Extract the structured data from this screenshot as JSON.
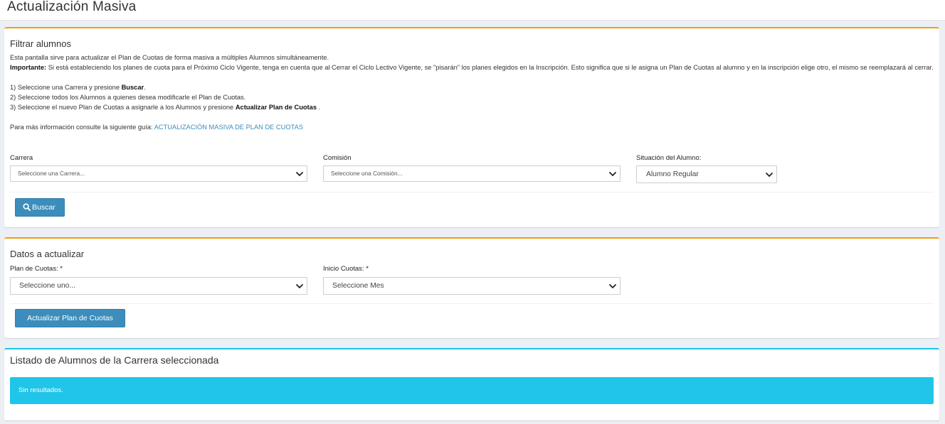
{
  "page": {
    "title": "Actualización Masiva"
  },
  "filter_box": {
    "title": "Filtrar alumnos",
    "intro_line1": "Esta pantalla sirve para actualizar el Plan de Cuotas de forma masiva a múltiples Alumnos simultáneamente.",
    "important_label": "Importante:",
    "important_text": " Si está estableciendo los planes de cuota para el Próximo Ciclo Vigente, tenga en cuenta que al Cerrar el Ciclo Lectivo Vigente, se \"pisarán\" los planes elegidos en la Inscripción. Esto significa que si le asigna un Plan de Cuotas al alumno y en la inscripción elige otro, el mismo se reemplazará al cerrar.",
    "step1_text": "1) Seleccione una Carrera y presione ",
    "step1_bold": "Buscar",
    "step1_end": ".",
    "step2_text": "2) Seleccione todos los Alumnos a quienes desea modificarle el Plan de Cuotas.",
    "step3_text": "3) Seleccione el nuevo Plan de Cuotas a asignarle a los Alumnos y presione ",
    "step3_bold": "Actualizar Plan de Cuotas",
    "step3_end": " .",
    "guide_text": "Para más información consulte la siguiente guía: ",
    "guide_link": "ACTUALIZACIÓN MASIVA DE PLAN DE CUOTAS",
    "carrera_label": "Carrera",
    "carrera_value": "Seleccione una Carrera...",
    "comision_label": "Comisión",
    "comision_value": "Seleccione una Comisión...",
    "situacion_label": "Situación del Alumno:",
    "situacion_value": "Alumno Regular",
    "search_button": "Buscar"
  },
  "update_box": {
    "title": "Datos a actualizar",
    "plan_label": "Plan de Cuotas: *",
    "plan_value": "Seleccione uno...",
    "inicio_label": "Inicio Cuotas: *",
    "inicio_value": "Seleccione Mes",
    "update_button": "Actualizar Plan de Cuotas"
  },
  "list_box": {
    "title": "Listado de Alumnos de la Carrera seleccionada",
    "empty_message": "Sin resultados."
  },
  "colors": {
    "accent_orange": "#f39c12",
    "accent_blue": "#1ec3e8",
    "button": "#3c8dbc",
    "alert": "#20c5e9",
    "link": "#3c8dbc"
  },
  "icons": [
    "search-icon",
    "chevron-down-icon"
  ]
}
